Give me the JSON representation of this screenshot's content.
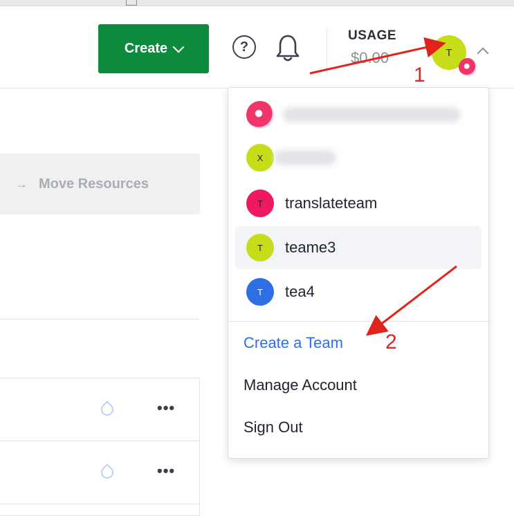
{
  "header": {
    "create_label": "Create",
    "usage_label": "USAGE",
    "usage_value": "$0.00",
    "avatar_initial": "T"
  },
  "background": {
    "move_resources_label": "Move Resources",
    "move_arrow": "→",
    "row_more": [
      "•••",
      "•••"
    ]
  },
  "menu": {
    "teams": [
      {
        "label": "",
        "initial": "",
        "color": "#f0356b",
        "obscured": true
      },
      {
        "label": "",
        "initial": "X",
        "color": "#c7dd1a",
        "obscured": true
      },
      {
        "label": "translateteam",
        "initial": "T",
        "color": "#f0185e"
      },
      {
        "label": "teame3",
        "initial": "T",
        "color": "#c7dd1a",
        "active": true
      },
      {
        "label": "tea4",
        "initial": "T",
        "color": "#2f6fe6"
      }
    ],
    "create_team": "Create a Team",
    "manage_account": "Manage Account",
    "sign_out": "Sign Out"
  },
  "annotations": {
    "step1": "1",
    "step2": "2",
    "color": "#e0231c"
  },
  "colors": {
    "primary_button": "#0e8a3e",
    "link": "#2f6fe6"
  }
}
